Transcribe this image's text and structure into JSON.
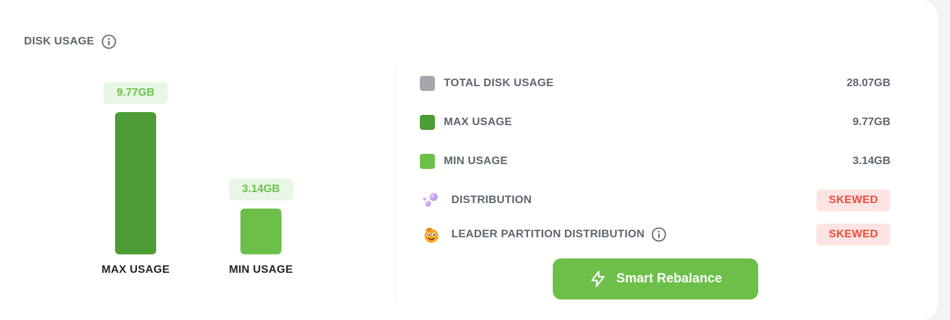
{
  "panel": {
    "title": "DISK USAGE",
    "title_icon": "info-icon"
  },
  "chart_data": {
    "type": "bar",
    "categories": [
      "MAX USAGE",
      "MIN USAGE"
    ],
    "values": [
      9.77,
      3.14
    ],
    "value_labels": [
      "9.77GB",
      "3.14GB"
    ],
    "unit": "GB",
    "colors": [
      "#4e9c35",
      "#6cc04a"
    ],
    "ylim": [
      0,
      9.77
    ],
    "grid": false
  },
  "stats": [
    {
      "label": "TOTAL DISK USAGE",
      "value": "28.07GB",
      "color": "#a3a6ad"
    },
    {
      "label": "MAX USAGE",
      "value": "9.77GB",
      "color": "#4e9c35"
    },
    {
      "label": "MIN USAGE",
      "value": "3.14GB",
      "color": "#6cc04a"
    }
  ],
  "distribution": {
    "label": "DISTRIBUTION",
    "icon": "bubbles-icon",
    "status": "SKEWED"
  },
  "leader_distribution": {
    "label": "LEADER PARTITION DISTRIBUTION",
    "icon": "smiley-face-icon",
    "info_icon": "info-icon",
    "status": "SKEWED"
  },
  "actions": {
    "rebalance_label": "Smart Rebalance",
    "rebalance_icon": "lightning-icon"
  },
  "colors": {
    "accent": "#6cc04a",
    "accent_dark": "#4e9c35",
    "danger": "#ef4b3f",
    "danger_bg": "#fde4e2"
  }
}
